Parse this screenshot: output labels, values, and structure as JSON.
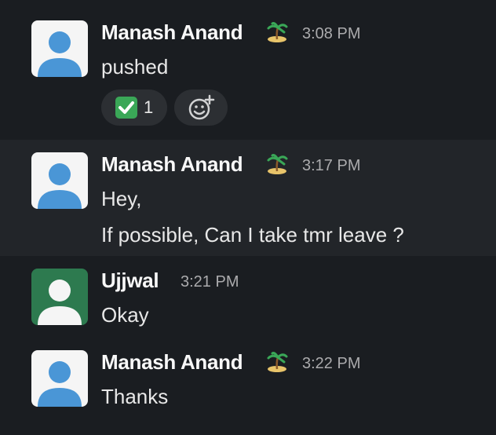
{
  "messages": [
    {
      "author": "Manash Anand",
      "status_emoji": "desert-island-icon",
      "time": "3:08 PM",
      "lines": [
        "pushed"
      ],
      "reactions": [
        {
          "emoji": "white-check-mark-icon",
          "count": "1"
        }
      ]
    },
    {
      "author": "Manash Anand",
      "status_emoji": "desert-island-icon",
      "time": "3:17 PM",
      "lines": [
        "Hey,",
        "If possible, Can I take tmr leave ?"
      ]
    },
    {
      "author": "Ujjwal",
      "time": "3:21 PM",
      "lines": [
        "Okay"
      ]
    },
    {
      "author": "Manash Anand",
      "status_emoji": "desert-island-icon",
      "time": "3:22 PM",
      "lines": [
        "Thanks"
      ]
    }
  ],
  "colors": {
    "background": "#1a1d21",
    "hover_background": "#222529",
    "avatar_default": "#f5f5f5",
    "avatar_figure": "#4a96d6",
    "avatar_ujjwal": "#2d7a4f",
    "reaction_pill": "#2c2f33",
    "check_green": "#3aa757"
  }
}
